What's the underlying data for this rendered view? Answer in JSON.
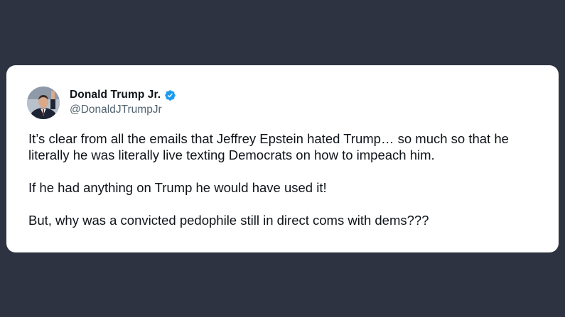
{
  "tweet": {
    "author": {
      "display_name": "Donald Trump Jr.",
      "handle": "@DonaldJTrumpJr",
      "verified": true,
      "verified_icon": "verified-badge-icon",
      "avatar_icon": "avatar-photo"
    },
    "paragraphs": [
      "It’s clear from all the emails that Jeffrey Epstein hated Trump… so much so that he literally he was literally live texting Democrats on how to impeach him.",
      "If he had anything on Trump he would have used it!",
      "But, why was a convicted pedophile still in direct coms with dems???"
    ]
  },
  "colors": {
    "page_background": "#2d3341",
    "card_background": "#ffffff",
    "text_primary": "#0f1419",
    "text_secondary": "#536471",
    "verified_blue": "#1d9bf0"
  }
}
